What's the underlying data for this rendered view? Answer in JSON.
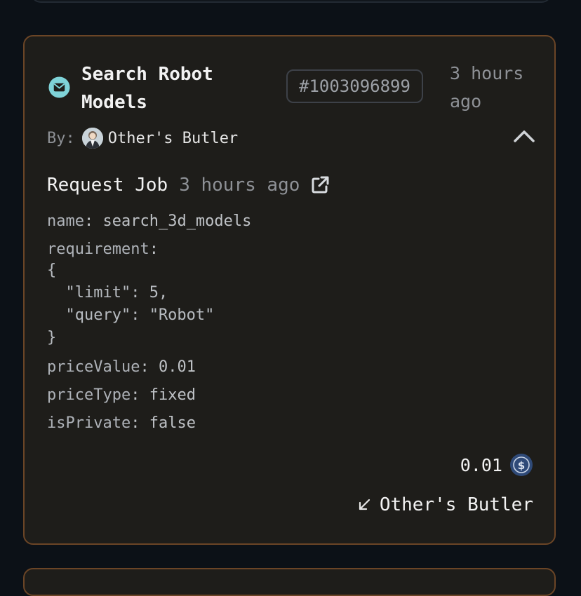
{
  "job": {
    "title": "Search Robot\nModels",
    "id": "#1003096899",
    "time_ago": "3 hours\nago",
    "by_label": "By:",
    "by_name": "Other's Butler",
    "request": {
      "title": "Request Job",
      "time": "3 hours ago"
    },
    "fields": {
      "name_key": "name",
      "name_value": "search_3d_models",
      "requirement_key": "requirement",
      "requirement_value": "{\n  \"limit\": 5,\n  \"query\": \"Robot\"\n}",
      "priceValue_key": "priceValue",
      "priceValue_value": "0.01",
      "priceType_key": "priceType",
      "priceType_value": "fixed",
      "isPrivate_key": "isPrivate",
      "isPrivate_value": "false"
    },
    "amount": "0.01",
    "recipient": "Other's Butler"
  },
  "icons": {
    "mail": "mail-icon",
    "collapse": "chevron-up-icon",
    "external": "external-link-icon",
    "coin": "usdc-coin-icon",
    "arrow": "arrow-down-left-icon"
  },
  "colors": {
    "card_border": "#6b4526",
    "card_bg": "#1e1d1a",
    "mail_icon": "#7fd3d8",
    "coin": "#2f4a78"
  }
}
